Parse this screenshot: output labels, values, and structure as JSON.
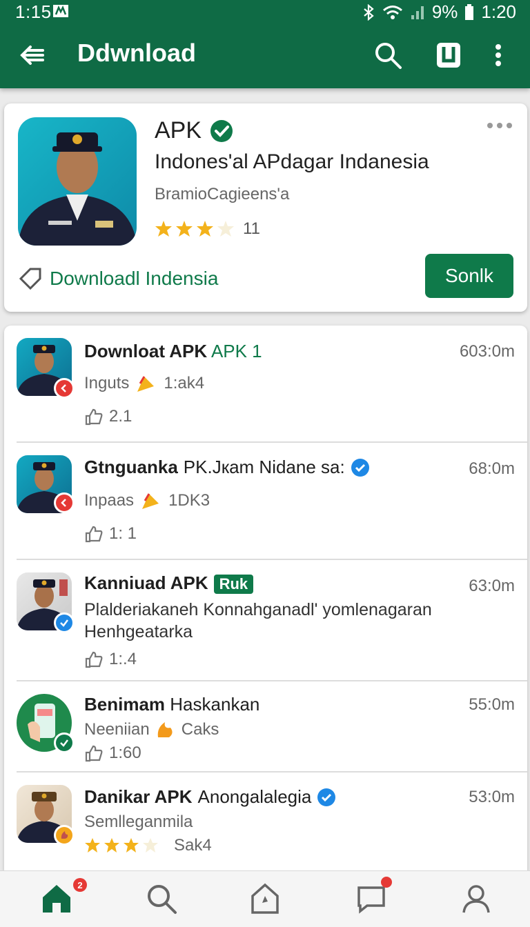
{
  "status_bar": {
    "time_left": "1:15",
    "battery": "9%",
    "time_right": "1:20"
  },
  "app_bar": {
    "title": "Ddwnload"
  },
  "featured": {
    "name": "APK",
    "subtitle": "Indones'al APdagar Indanesia",
    "developer": "BramioCagieens'a",
    "rating_text": "11",
    "rating_stars": 3,
    "download_link": "Downloadl Indensia",
    "install_label": "Sonlk"
  },
  "list": [
    {
      "title_bold": "Downloat APK",
      "title_green": "APK 1",
      "time": "603:0m",
      "meta_label": "Inguts",
      "meta_value": "1:ak4",
      "likes": "2.1"
    },
    {
      "title_bold": "Gtnguanka",
      "title_rest": "PK.Jкam Nidane sa:",
      "time": "68:0m",
      "meta_label": "Inpaas",
      "meta_value": "1DK3",
      "likes": "1: 1"
    },
    {
      "title_bold": "Kanniuad APK",
      "tag": "Ruk",
      "time": "63:0m",
      "desc_line1": "Plalderiakaneh Konnahganadl' yomlenagaran",
      "desc_line2": "Henhgeatarka",
      "likes": "1:.4"
    },
    {
      "title_bold": "Benimam",
      "title_rest": "Haskankan",
      "time": "55:0m",
      "meta_label": "Neeniian",
      "meta_value": "Caks",
      "likes": "1:60"
    },
    {
      "title_bold": "Danikar APK",
      "title_rest": "Anongalalegia",
      "time": "53:0m",
      "meta_label": "Semlleganmila",
      "rating_label": "Sak4",
      "rating_stars": 3
    }
  ],
  "bottom_nav": {
    "home_badge": "2"
  },
  "colors": {
    "primary": "#0f6b45",
    "accent": "#0f7a4a",
    "verified_blue": "#1e88e5",
    "badge_red": "#e53935",
    "star": "#f3b21b"
  }
}
